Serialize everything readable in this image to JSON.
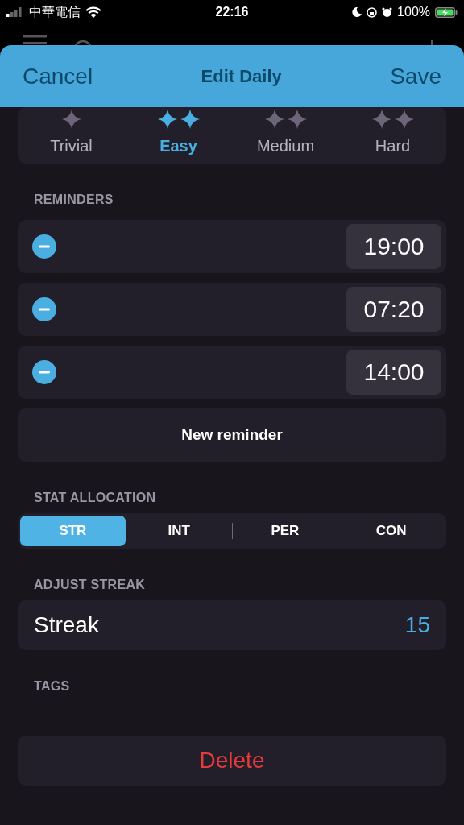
{
  "status_bar": {
    "carrier": "中華電信",
    "time": "22:16",
    "battery": "100%"
  },
  "header": {
    "cancel": "Cancel",
    "title": "Edit Daily",
    "save": "Save"
  },
  "difficulty": [
    {
      "label": "Trivial",
      "selected": false
    },
    {
      "label": "Easy",
      "selected": true
    },
    {
      "label": "Medium",
      "selected": false
    },
    {
      "label": "Hard",
      "selected": false
    }
  ],
  "reminders": {
    "heading": "REMINDERS",
    "items": [
      {
        "time": "19:00"
      },
      {
        "time": "07:20"
      },
      {
        "time": "14:00"
      }
    ],
    "add": "New reminder"
  },
  "stat_allocation": {
    "heading": "STAT ALLOCATION",
    "options": [
      {
        "label": "STR",
        "selected": true
      },
      {
        "label": "INT",
        "selected": false
      },
      {
        "label": "PER",
        "selected": false
      },
      {
        "label": "CON",
        "selected": false
      }
    ]
  },
  "streak": {
    "heading": "ADJUST STREAK",
    "label": "Streak",
    "value": "15"
  },
  "tags": {
    "heading": "TAGS"
  },
  "delete": "Delete"
}
